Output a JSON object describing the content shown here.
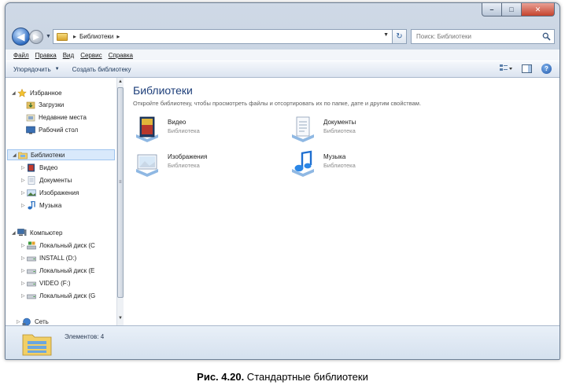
{
  "window": {
    "caption_buttons": {
      "minimize": "–",
      "maximize": "□",
      "close": "✕"
    }
  },
  "navigation": {
    "address_parts": [
      "Библиотеки"
    ],
    "search_placeholder": "Поиск: Библиотеки"
  },
  "menu": [
    "Файл",
    "Правка",
    "Вид",
    "Сервис",
    "Справка"
  ],
  "toolbar": {
    "organize_label": "Упорядочить",
    "new_library_label": "Создать библиотеку"
  },
  "sidebar": {
    "favorites": {
      "label": "Избранное",
      "items": [
        "Загрузки",
        "Недавние места",
        "Рабочий стол"
      ]
    },
    "libraries": {
      "label": "Библиотеки",
      "items": [
        "Видео",
        "Документы",
        "Изображения",
        "Музыка"
      ]
    },
    "computer": {
      "label": "Компьютер",
      "items": [
        "Локальный диск (C",
        "INSTALL (D:)",
        "Локальный диск (E",
        "VIDEO (F:)",
        "Локальный диск (G"
      ]
    },
    "network": {
      "label": "Сеть"
    }
  },
  "content": {
    "title": "Библиотеки",
    "description": "Откройте библиотеку, чтобы просмотреть файлы и отсортировать их по папке, дате и другим свойствам.",
    "libraries": [
      {
        "name": "Видео",
        "type": "Библиотека",
        "icon": "video-library-icon"
      },
      {
        "name": "Документы",
        "type": "Библиотека",
        "icon": "documents-library-icon"
      },
      {
        "name": "Изображения",
        "type": "Библиотека",
        "icon": "pictures-library-icon"
      },
      {
        "name": "Музыка",
        "type": "Библиотека",
        "icon": "music-library-icon"
      }
    ]
  },
  "details": {
    "items_count": "Элементов: 4"
  },
  "caption": {
    "label": "Рис. 4.20.",
    "text": " Стандартные библиотеки"
  },
  "colors": {
    "accent": "#1e3f7a",
    "selection": "#d9e9fb",
    "frame": "#bac8da"
  }
}
